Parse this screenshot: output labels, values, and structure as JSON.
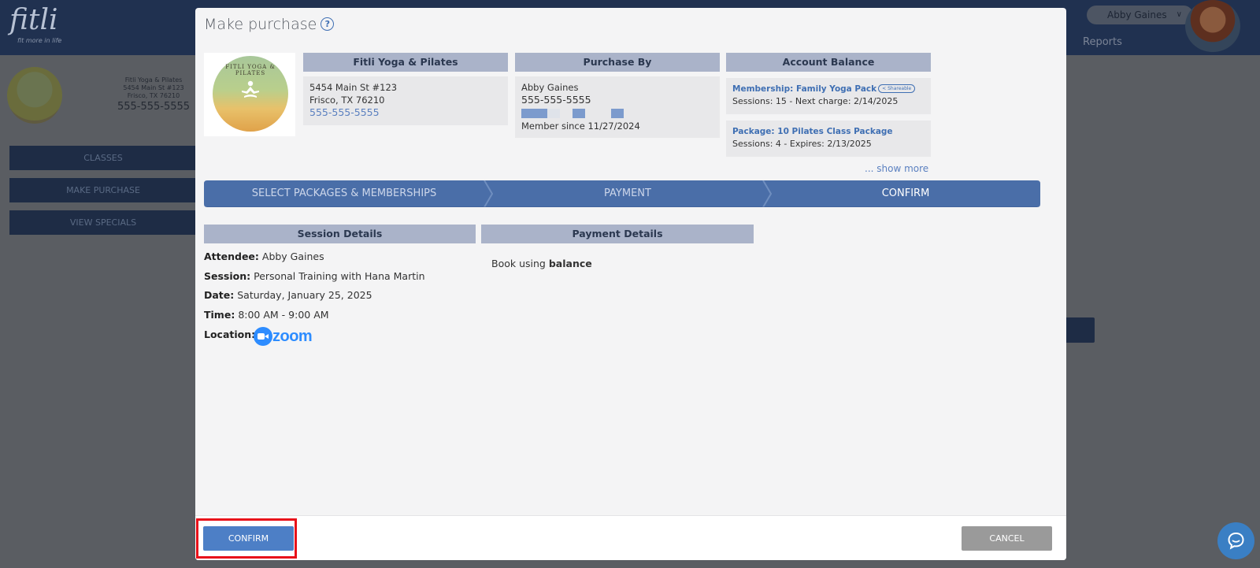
{
  "app": {
    "logo_text": "fitli",
    "tagline": "fit more in life",
    "user_name": "Abby Gaines",
    "user_chevron": "∨",
    "nav_reports": "Reports",
    "studio_name": "Fitli Yoga & Pilates",
    "studio_address1": "5454 Main St #123",
    "studio_address2": "Frisco, TX 76210",
    "studio_phone": "555-555-5555",
    "sidebar": [
      "CLASSES",
      "MAKE PURCHASE",
      "VIEW SPECIALS"
    ]
  },
  "modal": {
    "title": "Make purchase",
    "help_icon": "question-circle-icon",
    "studio_logo_text": "FITLI YOGA & PILATES",
    "studio": {
      "heading": "Fitli Yoga & Pilates",
      "address1": "5454 Main St #123",
      "address2": "Frisco, TX 76210",
      "phone": "555-555-5555"
    },
    "purchase_by": {
      "heading": "Purchase By",
      "name": "Abby Gaines",
      "phone": "555-555-5555",
      "member_since": "Member since 11/27/2024"
    },
    "account_balance": {
      "heading": "Account Balance",
      "items": [
        {
          "name": "Membership: Family Yoga Pack",
          "badge": "Shareable",
          "detail": "Sessions: 15 -  Next charge: 2/14/2025"
        },
        {
          "name": "Package: 10 Pilates Class Package",
          "badge": "",
          "detail": "Sessions: 4 -  Expires: 2/13/2025"
        }
      ],
      "show_more": "... show more"
    },
    "steps": [
      {
        "label": "SELECT PACKAGES & MEMBERSHIPS",
        "active": false
      },
      {
        "label": "PAYMENT",
        "active": false
      },
      {
        "label": "CONFIRM",
        "active": true
      }
    ],
    "session_details": {
      "heading": "Session Details",
      "attendee_label": "Attendee:",
      "attendee": "Abby Gaines",
      "session_label": "Session:",
      "session": "Personal Training with Hana Martin",
      "date_label": "Date:",
      "date": "Saturday, January 25, 2025",
      "time_label": "Time:",
      "time": "8:00 AM - 9:00 AM",
      "location_label": "Location:",
      "location": "zoom"
    },
    "payment_details": {
      "heading": "Payment Details",
      "prefix": "Book using",
      "method": "balance"
    },
    "confirm_label": "CONFIRM",
    "cancel_label": "CANCEL"
  },
  "colors": {
    "accent": "#4d7fc6",
    "stepper": "#4a6ea8",
    "header_bar": "#aab3c9",
    "highlight": "#e8101a",
    "zoom": "#2d8cff"
  }
}
